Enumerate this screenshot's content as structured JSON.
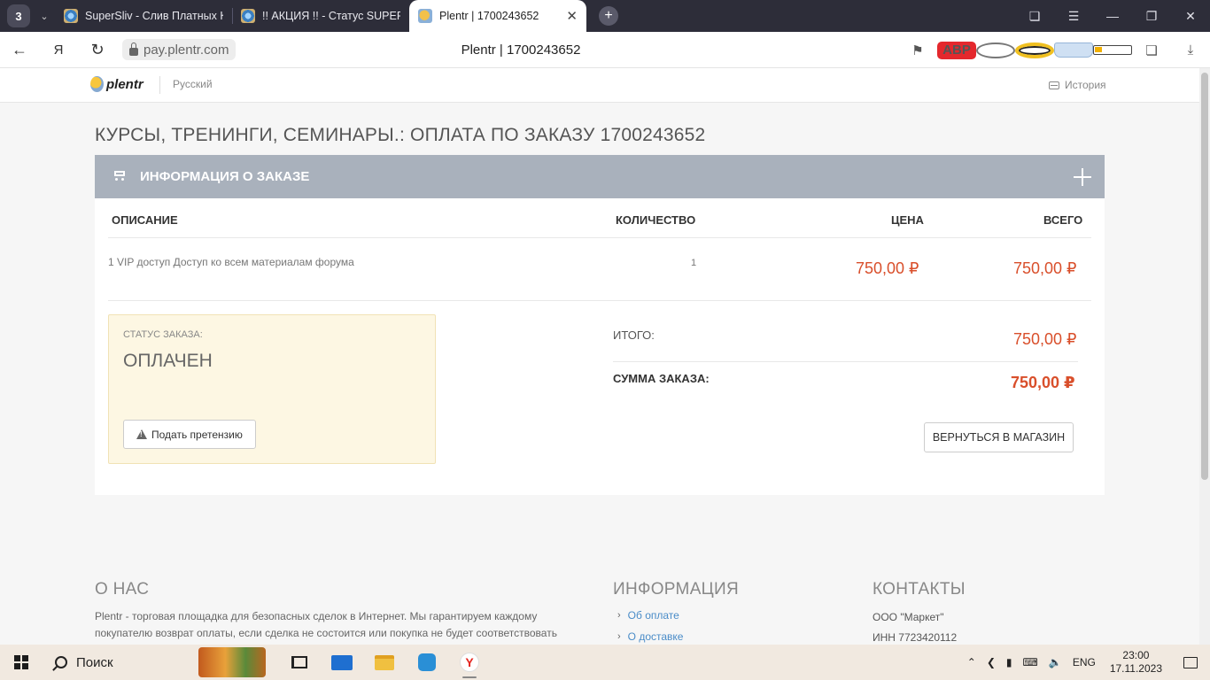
{
  "browser": {
    "tab_count": "3",
    "tabs": [
      {
        "title": "SuperSliv - Слив Платных К",
        "active": false
      },
      {
        "title": "!! АКЦИЯ !! - Статус SUPER",
        "active": false
      },
      {
        "title": "Plentr | 1700243652",
        "active": true
      }
    ],
    "url": "pay.plentr.com",
    "page_title": "Plentr | 1700243652",
    "ext": {
      "abp": "ABP"
    }
  },
  "header": {
    "logo_text": "plentr",
    "language": "Русский",
    "history": "История"
  },
  "page": {
    "title": "КУРСЫ, ТРЕНИНГИ, СЕМИНАРЫ.: ОПЛАТА ПО ЗАКАЗУ 1700243652"
  },
  "order": {
    "section_title": "ИНФОРМАЦИЯ О ЗАКАЗЕ",
    "columns": {
      "description": "ОПИСАНИЕ",
      "quantity": "КОЛИЧЕСТВО",
      "price": "ЦЕНА",
      "total": "ВСЕГО"
    },
    "items": [
      {
        "description": "1 VIP доступ Доступ ко всем материалам форума",
        "quantity": "1",
        "price": "750,00 ₽",
        "total": "750,00 ₽"
      }
    ],
    "status_label": "СТАТУС ЗАКАЗА:",
    "status_value": "ОПЛАЧЕН",
    "claim_button": "Подать претензию",
    "subtotal_label": "ИТОГО:",
    "subtotal_value": "750,00 ₽",
    "order_sum_label": "СУММА ЗАКАЗА:",
    "order_sum_value": "750,00 ₽",
    "return_button": "ВЕРНУТЬСЯ В МАГАЗИН"
  },
  "footer": {
    "about_heading": "О НАС",
    "about_text": "Plentr - торговая площадка для безопасных сделок в Интернет. Мы гарантируем каждому покупателю возврат оплаты, если сделка не состоится или покупка не будет соответствовать",
    "info_heading": "ИНФОРМАЦИЯ",
    "info_links": [
      "Об оплате",
      "О доставке"
    ],
    "contacts_heading": "КОНТАКТЫ",
    "contacts": [
      "ООО \"Маркет\"",
      "ИНН 7723420112"
    ]
  },
  "taskbar": {
    "search_label": "Поиск",
    "language": "ENG",
    "time": "23:00",
    "date": "17.11.2023"
  }
}
